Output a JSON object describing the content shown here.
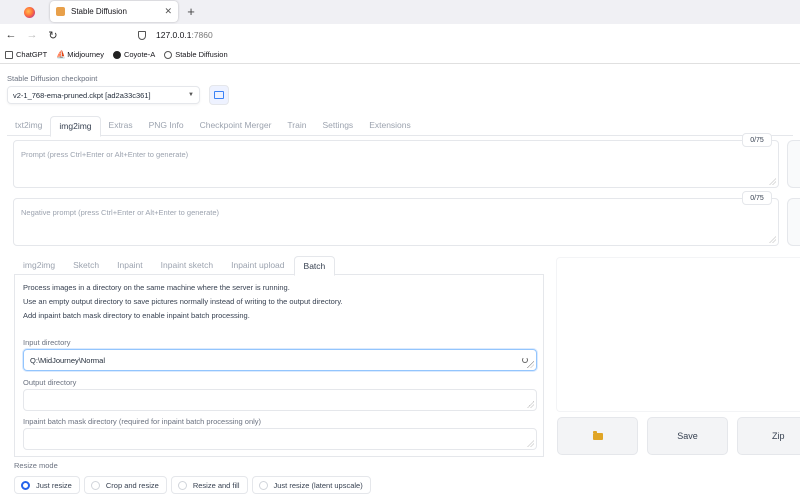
{
  "browser": {
    "tab_title": "Stable Diffusion",
    "url_host": "127.0.0.1",
    "url_port": ":7860",
    "bookmarks": [
      {
        "label": "ChatGPT",
        "icon": "chat-icon"
      },
      {
        "label": "Midjourney",
        "icon": "sail-icon"
      },
      {
        "label": "Coyote-A",
        "icon": "github-icon"
      },
      {
        "label": "Stable Diffusion",
        "icon": "globe-icon"
      }
    ]
  },
  "checkpoint": {
    "label": "Stable Diffusion checkpoint",
    "value": "v2-1_768-ema-pruned.ckpt [ad2a33c361]"
  },
  "main_tabs": [
    "txt2img",
    "img2img",
    "Extras",
    "PNG Info",
    "Checkpoint Merger",
    "Train",
    "Settings",
    "Extensions"
  ],
  "main_tab_active": "img2img",
  "prompt": {
    "placeholder": "Prompt (press Ctrl+Enter or Alt+Enter to generate)",
    "counter": "0/75"
  },
  "negative_prompt": {
    "placeholder": "Negative prompt (press Ctrl+Enter or Alt+Enter to generate)",
    "counter": "0/75"
  },
  "sub_tabs": [
    "img2img",
    "Sketch",
    "Inpaint",
    "Inpaint sketch",
    "Inpaint upload",
    "Batch"
  ],
  "sub_tab_active": "Batch",
  "batch": {
    "info_lines": [
      "Process images in a directory on the same machine where the server is running.",
      "Use an empty output directory to save pictures normally instead of writing to the output directory.",
      "Add inpaint batch mask directory to enable inpaint batch processing."
    ],
    "input_label": "Input directory",
    "input_value": "Q:\\MidJourney\\Normal",
    "output_label": "Output directory",
    "output_value": "",
    "mask_label": "Inpaint batch mask directory (required for inpaint batch processing only)",
    "mask_value": ""
  },
  "actions": {
    "folder_icon": "folder-icon",
    "save_label": "Save",
    "zip_label": "Zip"
  },
  "resize_mode": {
    "label": "Resize mode",
    "options": [
      "Just resize",
      "Crop and resize",
      "Resize and fill",
      "Just resize (latent upscale)"
    ],
    "selected": "Just resize"
  },
  "colors": {
    "accent": "#2563eb",
    "folder": "#e0a526"
  }
}
